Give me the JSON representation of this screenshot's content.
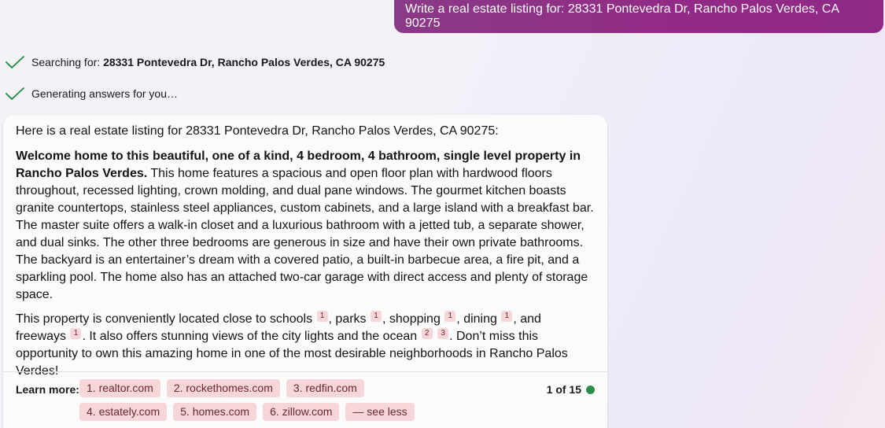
{
  "user_message": "Write a real estate listing for: 28331 Pontevedra Dr, Rancho Palos Verdes, CA 90275",
  "status": {
    "searching_prefix": "Searching for: ",
    "searching_query": "28331 Pontevedra Dr, Rancho Palos Verdes, CA 90275",
    "generating": "Generating answers for you…",
    "check_color": "#1f8a3a"
  },
  "answer": {
    "intro": "Here is a real estate listing for 28331 Pontevedra Dr, Rancho Palos Verdes, CA 90275:",
    "p1_bold": "Welcome home to this beautiful, one of a kind, 4 bedroom, 4 bathroom, single level property in Rancho Palos Verdes.",
    "p1_text": " This home features a spacious and open floor plan with hardwood floors throughout, recessed lighting, crown molding, and dual pane windows. The gourmet kitchen boasts granite countertops, stainless steel appliances, custom cabinets, and a large island with a breakfast bar. The master suite offers a walk-in closet and a luxurious bathroom with a jetted tub, a separate shower, and dual sinks. The other three bedrooms are generous in size and have their own private bathrooms. The backyard is an entertainer’s dream with a covered patio, a built-in barbecue area, a fire pit, and a sparkling pool. The home also has an attached two-car garage with direct access and plenty of storage space.",
    "p2": {
      "t1": "This property is conveniently located close to schools",
      "t2": ", parks",
      "t3": ", shopping",
      "t4": ", dining",
      "t5": ", and freeways ",
      "t6": ". It also offers stunning views of the city lights and the ocean",
      "t7": ". Don’t miss this opportunity to own this amazing home in one of the most desirable neighborhoods in Rancho Palos Verdes!",
      "refs": {
        "schools": "1",
        "parks": "1",
        "shopping": "1",
        "dining": "1",
        "freeways": "1",
        "ocean_a": "2",
        "ocean_b": "3"
      }
    }
  },
  "footer": {
    "learn_more": "Learn more:",
    "links": [
      "1. realtor.com",
      "2. rockethomes.com",
      "3. redfin.com",
      "4. estately.com",
      "5. homes.com",
      "6. zillow.com",
      "— see less"
    ],
    "page_indicator": "1 of 15",
    "indicator_color": "#2e8b4a"
  },
  "colors": {
    "user_bubble": "#8e2a86",
    "chip_bg": "#f6d6d9",
    "chip_text": "#6d2830"
  }
}
